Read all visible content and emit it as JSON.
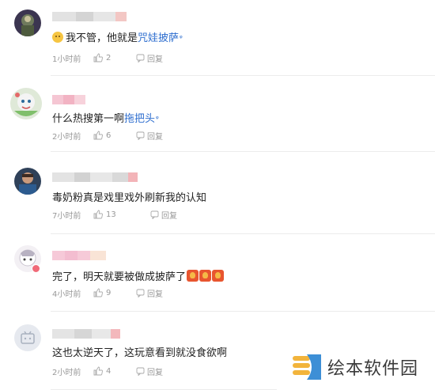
{
  "comments": [
    {
      "text_before": "我不管，他就是",
      "link": "咒娃披萨",
      "text_after": "",
      "time": "1小时前",
      "likes": "2",
      "reply_label": "回复"
    },
    {
      "text_before": "什么热搜第一啊",
      "link": "拖把头",
      "text_after": "",
      "time": "2小时前",
      "likes": "6",
      "reply_label": "回复"
    },
    {
      "text_before": "毒奶粉真是戏里戏外刷新我的认知",
      "link": "",
      "text_after": "",
      "time": "7小时前",
      "likes": "13",
      "reply_label": "回复"
    },
    {
      "text_before": "完了，明天就要被做成披萨了",
      "link": "",
      "text_after": "",
      "time": "4小时前",
      "likes": "9",
      "reply_label": "回复"
    },
    {
      "text_before": "这也太逆天了，这玩意看到就没食欲啊",
      "link": "",
      "text_after": "",
      "time": "2小时前",
      "likes": "4",
      "reply_label": "回复"
    }
  ],
  "watermark": {
    "text": "绘本软件园"
  },
  "colors": {
    "link": "#2e6ecf",
    "meta": "#999999",
    "text": "#222222"
  },
  "icons": {
    "like": "thumb-up-icon",
    "reply": "reply-icon",
    "search": "search-mark-icon"
  }
}
